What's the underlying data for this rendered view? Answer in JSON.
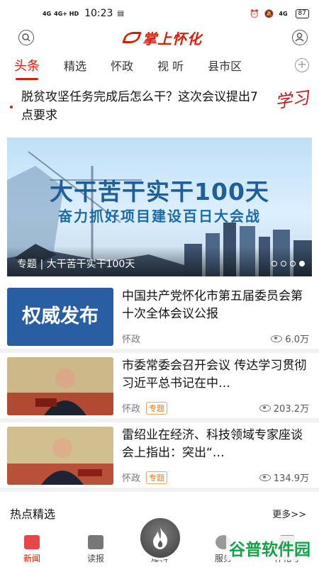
{
  "status_bar": {
    "signal1": "4G",
    "signal2": "4G+ HD",
    "time": "10:23",
    "right_signal": "4G",
    "battery": "87"
  },
  "header": {
    "logo_text": "掌上怀化"
  },
  "tabs": [
    "头条",
    "精选",
    "怀政",
    "视 听",
    "县市区"
  ],
  "headline": {
    "text": "脱贫攻坚任务完成后怎么干？这次会议提出7点要求",
    "stamp": "学习"
  },
  "banner": {
    "title": "大干苦干实干100天",
    "subtitle": "奋力抓好项目建设百日大会战",
    "caption": "专题 | 大干苦干实干100天",
    "dots": 4,
    "active_dot": 3
  },
  "news": [
    {
      "thumb_type": "text",
      "thumb_text": "权威发布",
      "title": "中国共产党怀化市第五届委员会第十次全体会议公报",
      "source": "怀政",
      "tag": "",
      "views": "6.0万"
    },
    {
      "thumb_type": "photo",
      "thumb_text": "",
      "title": "市委常委会召开会议 传达学习贯彻习近平总书记在中…",
      "source": "怀政",
      "tag": "专题",
      "views": "203.2万"
    },
    {
      "thumb_type": "photo",
      "thumb_text": "",
      "title": "雷绍业在经济、科技领域专家座谈会上指出：突出“…",
      "source": "怀政",
      "tag": "专题",
      "views": "134.9万"
    }
  ],
  "hot": {
    "title": "热点精选",
    "more": "更多>>"
  },
  "bottom_nav": [
    {
      "label": "新闻"
    },
    {
      "label": "读报"
    },
    {
      "label": "爆料"
    },
    {
      "label": "服务"
    },
    {
      "label": "怀化号"
    }
  ],
  "watermark": "谷普软件园",
  "colors": {
    "brand_red": "#d81e06",
    "banner_blue": "#1f5e9a",
    "watermark_green": "#14a34a"
  }
}
